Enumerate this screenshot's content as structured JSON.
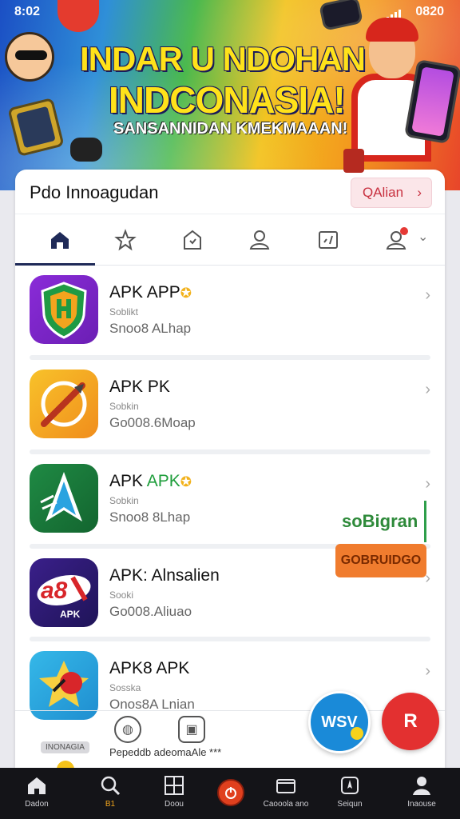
{
  "status_bar": {
    "time": "8:02",
    "right_text": "0820"
  },
  "banner": {
    "title_line1": "INDAR U NDOHAN",
    "title_line2": "INDCONASIA!",
    "subtitle": "SANSANNIDAN KMEKMAAAN!"
  },
  "card": {
    "title": "Pdo Innoagudan",
    "action_button": "QAlian",
    "action_chevron": "›"
  },
  "tabs": [
    {
      "icon": "home-icon",
      "active": true
    },
    {
      "icon": "star-icon",
      "active": false
    },
    {
      "icon": "warning-icon",
      "active": false
    },
    {
      "icon": "user-icon",
      "active": false
    },
    {
      "icon": "check-box-icon",
      "active": false
    },
    {
      "icon": "account-badge-icon",
      "active": false
    }
  ],
  "apps": [
    {
      "name": "APK APP",
      "accent": "",
      "sub": "Soblikt",
      "size": "Snoo8 ALhap",
      "icon": "shield-app-icon"
    },
    {
      "name": "APK PK",
      "accent": "",
      "sub": "Sobkin",
      "size": "Go008.6Moap",
      "icon": "compass-app-icon"
    },
    {
      "name": "APK ",
      "accent": "APK",
      "sub": "Sobkin",
      "size": "Snoo8 8Lhap",
      "icon": "arrow-app-icon"
    },
    {
      "name": "APK: Alnsalien",
      "accent": "",
      "sub": "Sooki",
      "size": "Go008.Aliuao",
      "icon": "apk-logo-app-icon"
    },
    {
      "name": "APK8 APK",
      "accent": "",
      "sub": "Sosska",
      "size": "Onos8A Lnian",
      "icon": "star-badge-app-icon"
    }
  ],
  "chevron": "›",
  "bottom_row": {
    "tag": "INONAGIA",
    "label": "Pepeddb adeomaAle ***"
  },
  "promo": {
    "top_text": "soBigran",
    "bottom_text": "GOBRUIDGO"
  },
  "fabs": {
    "blue_text": "WSV",
    "red_text": "R"
  },
  "nav": [
    {
      "label": "Dadon",
      "icon": "home-icon"
    },
    {
      "label": "B1",
      "icon": "search-icon",
      "active": true
    },
    {
      "label": "Doou",
      "icon": "grid-icon"
    },
    {
      "label": "",
      "icon": "power-icon"
    },
    {
      "label": "Caooola ano",
      "icon": "wallet-icon"
    },
    {
      "label": "Seiqun",
      "icon": "compass-icon"
    },
    {
      "label": "Inaouse",
      "icon": "profile-icon"
    }
  ],
  "colors": {
    "accent": "#1f2a58",
    "qa_bg": "#fbe6e9",
    "qa_text": "#c8303f",
    "nav_bg": "#141418",
    "nav_active": "#f2a51c"
  }
}
